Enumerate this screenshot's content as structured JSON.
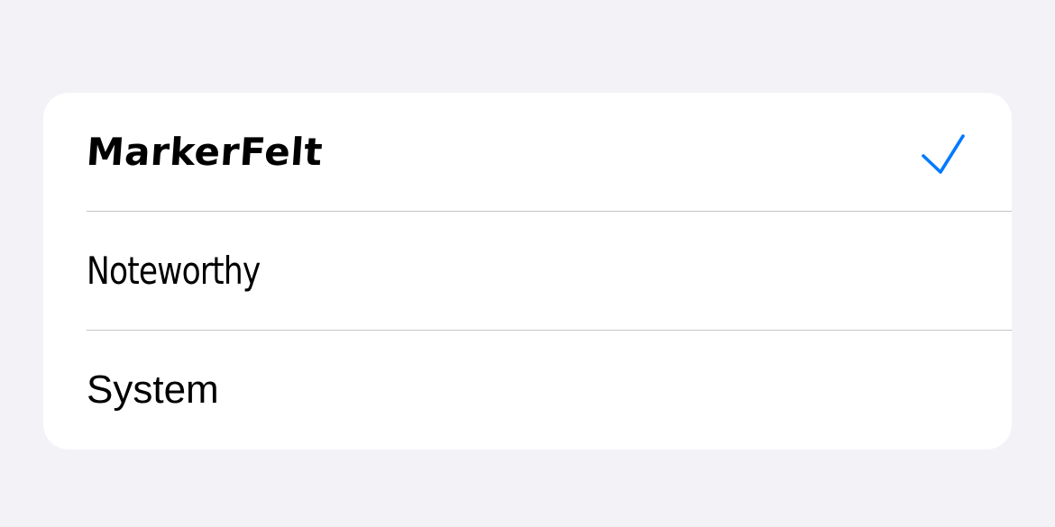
{
  "font_picker": {
    "options": [
      {
        "label": "MarkerFelt",
        "selected": true
      },
      {
        "label": "Noteworthy",
        "selected": false
      },
      {
        "label": "System",
        "selected": false
      }
    ],
    "check_icon": "checkmark-icon",
    "accent_color": "#007aff",
    "background_color": "#f2f2f7"
  }
}
